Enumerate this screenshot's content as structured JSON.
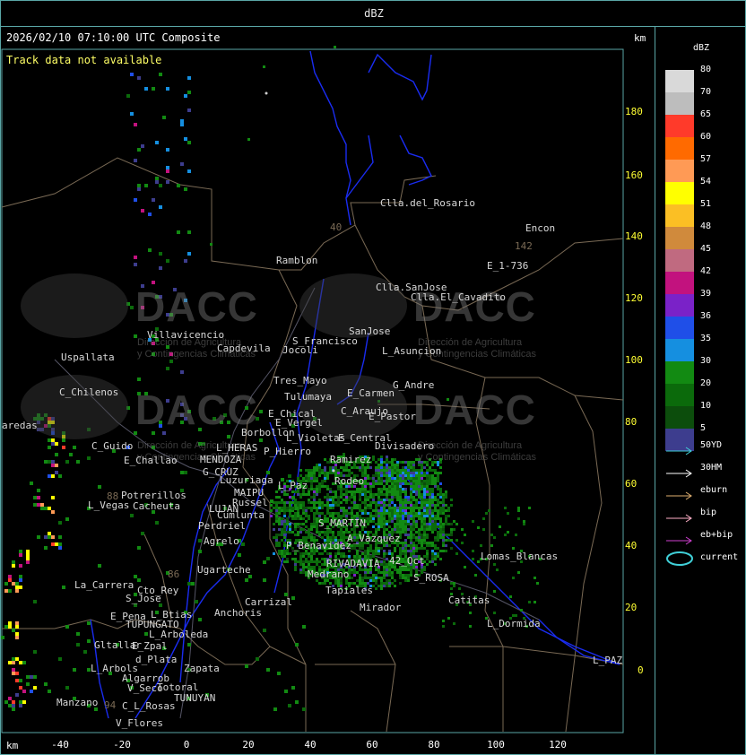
{
  "window": {
    "title": "dBZ"
  },
  "map": {
    "timestamp": "2026/02/10 07:10:00 UTC Composite",
    "track_status": "Track data not available",
    "km_label": "km",
    "x_ticks": [
      "-40",
      "-20",
      "0",
      "20",
      "40",
      "60",
      "80",
      "100",
      "120"
    ],
    "y_ticks": [
      "180",
      "160",
      "140",
      "120",
      "100",
      "80",
      "60",
      "40",
      "20",
      "0"
    ],
    "watermark": {
      "brand": "DACC",
      "subtitle_line1": "Dirección de Agricultura",
      "subtitle_line2": "y Contingencias Climáticas"
    },
    "places": [
      {
        "name": "Clla.del_Rosario"
      },
      {
        "name": "Encon"
      },
      {
        "name": "142"
      },
      {
        "name": "E_1-736"
      },
      {
        "name": "Ramblon"
      },
      {
        "name": "40"
      },
      {
        "name": "Clla.SanJose"
      },
      {
        "name": "Clla.El_Cavadito"
      },
      {
        "name": "Villavicencio"
      },
      {
        "name": "Uspallata"
      },
      {
        "name": "Capdevila"
      },
      {
        "name": "Jocoli"
      },
      {
        "name": "S_Francisco"
      },
      {
        "name": "SanJose"
      },
      {
        "name": "L_Asuncion"
      },
      {
        "name": "Tres_Mayo"
      },
      {
        "name": "Tulumaya"
      },
      {
        "name": "G_Andre"
      },
      {
        "name": "E_Carmen"
      },
      {
        "name": "C_Chilenos"
      },
      {
        "name": "aredas"
      },
      {
        "name": "E_Chical"
      },
      {
        "name": "E_Vergel"
      },
      {
        "name": "C_Araujo"
      },
      {
        "name": "E_Pastor"
      },
      {
        "name": "Borbollon"
      },
      {
        "name": "L_Violetas"
      },
      {
        "name": "E_Central"
      },
      {
        "name": "Divisadero"
      },
      {
        "name": "C_Guido"
      },
      {
        "name": "L_HERAS"
      },
      {
        "name": "P_Hierro"
      },
      {
        "name": "E_Challao"
      },
      {
        "name": "MENDOZA"
      },
      {
        "name": "Ramirez"
      },
      {
        "name": "G_CRUZ"
      },
      {
        "name": "Luzuriaga"
      },
      {
        "name": "L_Paz"
      },
      {
        "name": "Rodeo"
      },
      {
        "name": "88"
      },
      {
        "name": "Potrerillos"
      },
      {
        "name": "MAIPU"
      },
      {
        "name": "L_Vegas"
      },
      {
        "name": "Cacheuta"
      },
      {
        "name": "Russel"
      },
      {
        "name": "LUJAN"
      },
      {
        "name": "Cumlunta"
      },
      {
        "name": "Perdriel"
      },
      {
        "name": "S_MARTIN"
      },
      {
        "name": "A_Vazquez"
      },
      {
        "name": "Agrelo"
      },
      {
        "name": "P_Benavidez"
      },
      {
        "name": "Lomas_Blancas"
      },
      {
        "name": "RIVADAVIA"
      },
      {
        "name": "42_Oct"
      },
      {
        "name": "Ugarteche"
      },
      {
        "name": "86"
      },
      {
        "name": "Medrano"
      },
      {
        "name": "S_ROSA"
      },
      {
        "name": "La_Carrera"
      },
      {
        "name": "Cto_Rey"
      },
      {
        "name": "S_Jose"
      },
      {
        "name": "Carrizal"
      },
      {
        "name": "Catitas"
      },
      {
        "name": "Tapiales"
      },
      {
        "name": "E_Pena"
      },
      {
        "name": "L_Btias"
      },
      {
        "name": "Anchoris"
      },
      {
        "name": "TUPUNGATO"
      },
      {
        "name": "Mirador"
      },
      {
        "name": "L_Dormida"
      },
      {
        "name": "L_Arboleda"
      },
      {
        "name": "Gltallar"
      },
      {
        "name": "E_Zpal"
      },
      {
        "name": "d_Plata"
      },
      {
        "name": "L_Arbols"
      },
      {
        "name": "Zapata"
      },
      {
        "name": "Algarrob"
      },
      {
        "name": "V_Seco"
      },
      {
        "name": "Totoral"
      },
      {
        "name": "TUNUYAN"
      },
      {
        "name": "Manzano"
      },
      {
        "name": "94"
      },
      {
        "name": "C_L_Rosas"
      },
      {
        "name": "V_Flores"
      },
      {
        "name": "L_PAZ"
      }
    ]
  },
  "legend": {
    "title": "dBZ",
    "levels": [
      {
        "label": "80",
        "color": "#d9d9d9"
      },
      {
        "label": "70",
        "color": "#bdbdbd"
      },
      {
        "label": "65",
        "color": "#ff3a2a"
      },
      {
        "label": "60",
        "color": "#ff6a00"
      },
      {
        "label": "57",
        "color": "#ff9a55"
      },
      {
        "label": "54",
        "color": "#ffff00"
      },
      {
        "label": "51",
        "color": "#fbbf24"
      },
      {
        "label": "48",
        "color": "#d08a3c"
      },
      {
        "label": "45",
        "color": "#c06a80"
      },
      {
        "label": "42",
        "color": "#c2127e"
      },
      {
        "label": "39",
        "color": "#7a22c8"
      },
      {
        "label": "36",
        "color": "#1f4fe8"
      },
      {
        "label": "35",
        "color": "#158fe0"
      },
      {
        "label": "30",
        "color": "#128a12"
      },
      {
        "label": "20",
        "color": "#0b6a0b"
      },
      {
        "label": "10",
        "color": "#0c4d0c"
      },
      {
        "label": "5",
        "color": "#3d3d8e"
      }
    ],
    "tracks": [
      {
        "label": "50YD",
        "color": "#40d0d8"
      },
      {
        "label": "30HM",
        "color": "#ffffff"
      },
      {
        "label": "eburn",
        "color": "#e0b070"
      },
      {
        "label": "bip",
        "color": "#ffb0c8"
      },
      {
        "label": "eb+bip",
        "color": "#d040d0"
      },
      {
        "label": "current",
        "color": "#40d0d8"
      }
    ]
  }
}
